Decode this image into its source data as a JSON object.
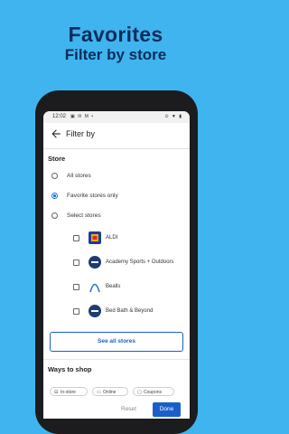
{
  "promo": {
    "title": "Favorites",
    "subtitle": "Filter by store"
  },
  "statusbar": {
    "time": "12:02",
    "left_icons": "▣ ✉ M •",
    "right_icons": "⊙ ▼ ▮"
  },
  "appbar": {
    "back_icon": "arrow-back-icon",
    "title": "Filter by"
  },
  "store_section": {
    "title": "Store",
    "options": [
      {
        "label": "All stores",
        "selected": false
      },
      {
        "label": "Favorite stores only",
        "selected": true
      },
      {
        "label": "Select stores",
        "selected": false
      }
    ],
    "stores": [
      {
        "label": "ALDI",
        "checked": false,
        "logo_color": "#1c3f94"
      },
      {
        "label": "Academy Sports + Outdoors",
        "checked": false,
        "logo_color": "#1f3b73"
      },
      {
        "label": "Bealls",
        "checked": false,
        "logo_color": "#2a73c9"
      },
      {
        "label": "Bed Bath & Beyond",
        "checked": false,
        "logo_color": "#1d3c78"
      }
    ],
    "see_all_label": "See all stores"
  },
  "shop_section": {
    "title": "Ways to shop",
    "chips": [
      {
        "label": "In-store",
        "icon": "storefront-icon"
      },
      {
        "label": "Online",
        "icon": "laptop-icon"
      },
      {
        "label": "Coupons",
        "icon": "coupon-icon"
      }
    ]
  },
  "actions": {
    "reset_label": "Reset",
    "done_label": "Done"
  },
  "colors": {
    "background": "#3fb4ee",
    "headline": "#0b2d5c",
    "accent": "#1a5fc9"
  }
}
